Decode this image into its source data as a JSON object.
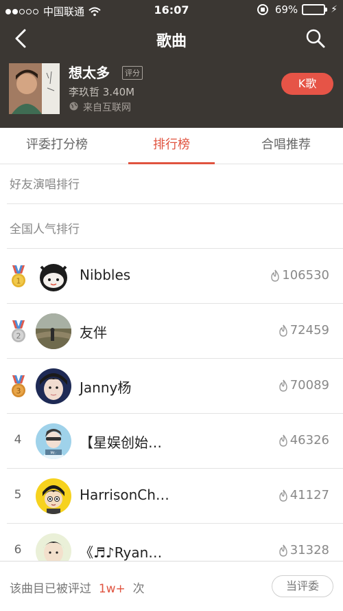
{
  "status_bar": {
    "carrier": "中国联通",
    "time": "16:07",
    "battery": "69%",
    "battery_level": 0.69
  },
  "nav": {
    "title": "歌曲"
  },
  "song": {
    "name": "想太多",
    "tag": "评分",
    "artist_size": "李玖哲  3.40M",
    "source": "来自互联网",
    "k_button": "K歌"
  },
  "tabs": [
    {
      "label": "评委打分榜",
      "active": false
    },
    {
      "label": "排行榜",
      "active": true
    },
    {
      "label": "合唱推荐",
      "active": false
    }
  ],
  "sections": {
    "friends": "好友演唱排行",
    "national": "全国人气排行"
  },
  "ranking": [
    {
      "rank": "1",
      "medal": "gold",
      "name": "Nibbles",
      "score": "106530"
    },
    {
      "rank": "2",
      "medal": "silver",
      "name": "友伴",
      "score": "72459"
    },
    {
      "rank": "3",
      "medal": "bronze",
      "name": "Janny杨",
      "score": "70089"
    },
    {
      "rank": "4",
      "medal": "",
      "name": "【星娱创始…",
      "score": "46326"
    },
    {
      "rank": "5",
      "medal": "",
      "name": "HarrisonCh…",
      "score": "41127"
    },
    {
      "rank": "6",
      "medal": "",
      "name": "《♬♪Ryan…",
      "score": "31328"
    }
  ],
  "footer": {
    "prefix": "该曲目已被评过",
    "count": "1w+",
    "suffix": "次",
    "judge_button": "当评委"
  },
  "colors": {
    "header_bg": "#3b3733",
    "accent": "#e0533f",
    "k_button": "#e65447",
    "gold": "#e5b32c",
    "silver": "#b8b8b8",
    "bronze": "#d48a2c"
  }
}
